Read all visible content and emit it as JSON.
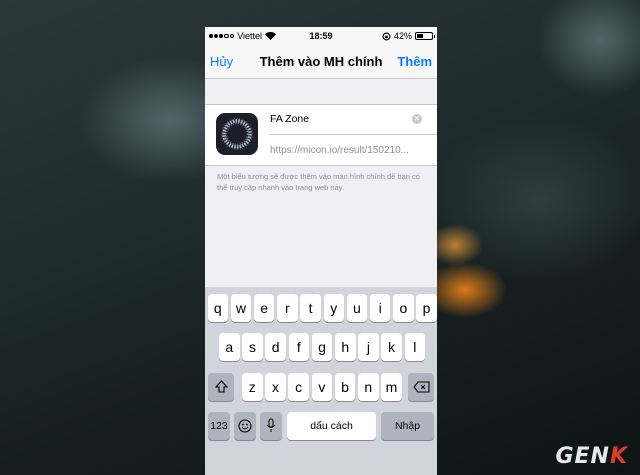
{
  "status_bar": {
    "carrier": "Viettel",
    "time": "18:59",
    "battery_percent": "42%",
    "battery_level": 0.42
  },
  "nav": {
    "left": "Hủy",
    "title": "Thêm vào MH chính",
    "right": "Thêm"
  },
  "app": {
    "name": "FA Zone",
    "url": "https://micon.io/result/150210..."
  },
  "description": "Một biểu tượng sẽ được thêm vào màn hình chính để bạn có thể truy cập nhanh vào trang web này.",
  "keyboard": {
    "row1": [
      "q",
      "w",
      "e",
      "r",
      "t",
      "y",
      "u",
      "i",
      "o",
      "p"
    ],
    "row2": [
      "a",
      "s",
      "d",
      "f",
      "g",
      "h",
      "j",
      "k",
      "l"
    ],
    "row3": [
      "z",
      "x",
      "c",
      "v",
      "b",
      "n",
      "m"
    ],
    "numbers_key": "123",
    "space_label": "dấu cách",
    "return_label": "Nhập"
  },
  "watermark": {
    "text_main": "GEN",
    "text_accent": "K"
  },
  "colors": {
    "accent": "#0a7aff",
    "keyboard_bg": "#d1d5db",
    "watermark_accent": "#e23a2a"
  }
}
